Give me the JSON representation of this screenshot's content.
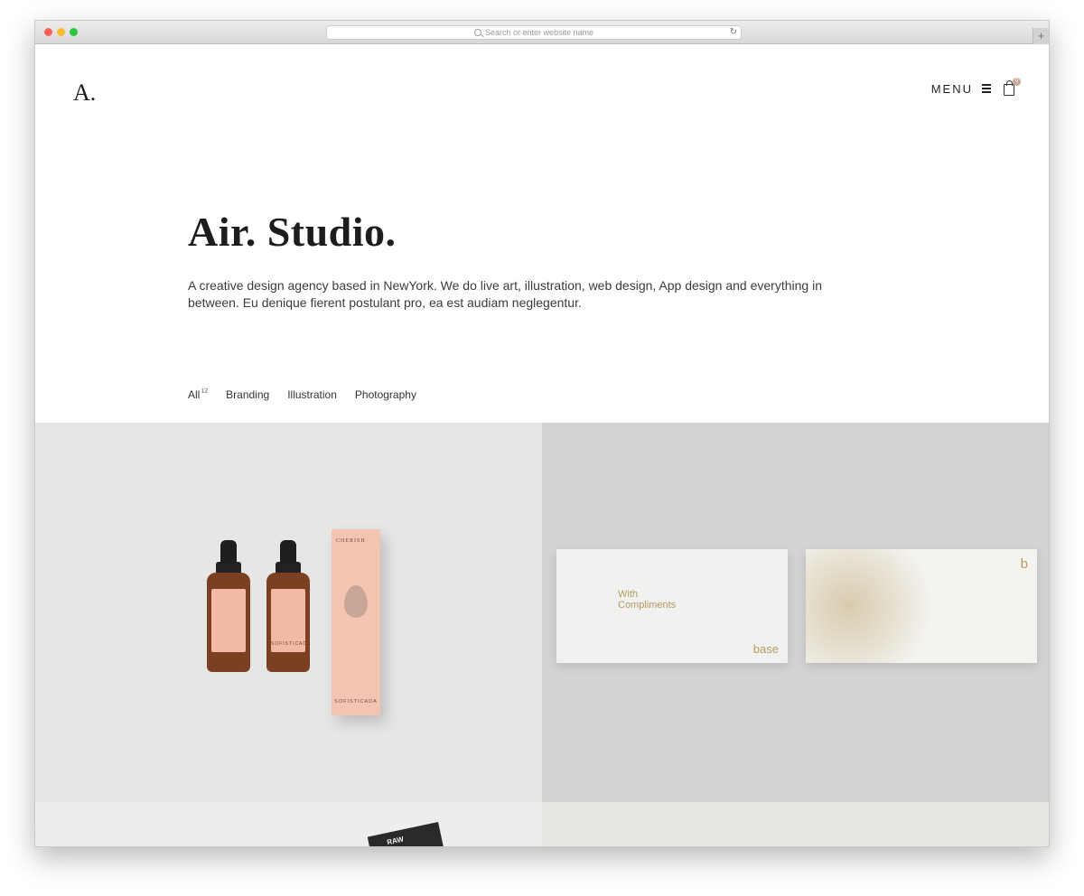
{
  "browser": {
    "url_placeholder": "Search or enter website name",
    "new_tab_label": "+"
  },
  "header": {
    "logo": "A.",
    "menu_label": "MENU",
    "cart_count": "0"
  },
  "hero": {
    "title": "Air. Studio.",
    "description": "A creative design agency based in NewYork. We do live art, illustration, web design, App design and everything in between. Eu denique fierent postulant pro, ea est audiam neglegentur."
  },
  "filters": {
    "items": [
      {
        "label": "All",
        "count": "12"
      },
      {
        "label": "Branding"
      },
      {
        "label": "Illustration"
      },
      {
        "label": "Photography"
      }
    ]
  },
  "portfolio": {
    "tile1": {
      "box_title": "CHERISH",
      "box_brand": "SOFISTICADA",
      "bottle_label": "SOFISTICADA"
    },
    "tile2": {
      "card_heading": "With\nCompliments",
      "card_brand": "base",
      "card_mark": "b"
    },
    "tile3": {
      "art_text": "RAW"
    }
  },
  "colors": {
    "accent_gold": "#b59a5e",
    "badge": "#c9a99a",
    "text_dark": "#1d1d1d"
  }
}
